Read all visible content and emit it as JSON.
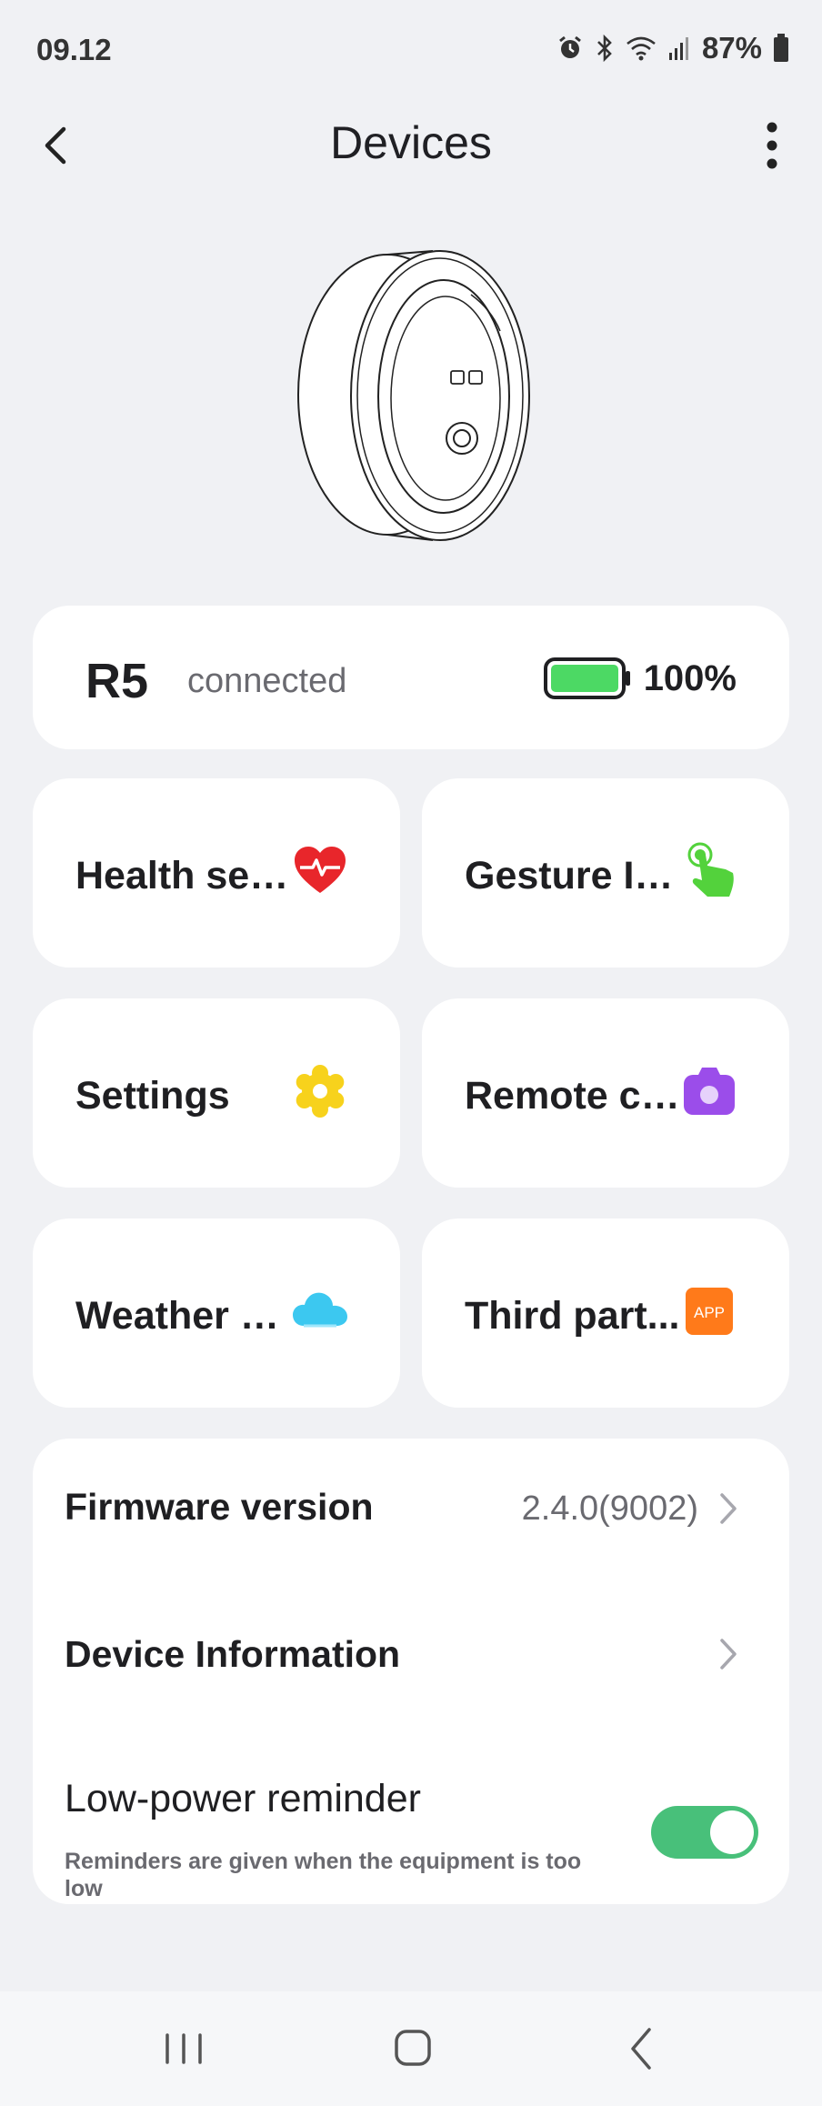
{
  "status_bar": {
    "time": "09.12",
    "battery": "87%",
    "icons": [
      "alarm-icon",
      "bluetooth-icon",
      "wifi-icon",
      "signal-icon",
      "battery-icon"
    ]
  },
  "header": {
    "title": "Devices",
    "back_icon": "back-arrow-icon",
    "menu_icon": "more-vertical-icon"
  },
  "device": {
    "name": "R5",
    "state": "connected",
    "battery_level": "100%",
    "battery_fill": 1.0,
    "battery_color": "#4cd964"
  },
  "tiles": [
    {
      "label": "Health set...",
      "icon": "heart-pulse-icon",
      "color": "#e8262b"
    },
    {
      "label": "Gesture In...",
      "icon": "tap-hand-icon",
      "color": "#53d23c"
    },
    {
      "label": "Settings",
      "icon": "gear-icon",
      "color": "#f7d21c"
    },
    {
      "label": "Remote ca...",
      "icon": "camera-icon",
      "color": "#9b4dea"
    },
    {
      "label": "Weather p...",
      "icon": "cloud-icon",
      "color": "#3cc8f0"
    },
    {
      "label": "Third part...",
      "icon": "app-icon",
      "color": "#ff7a1a",
      "badge_text": "APP"
    }
  ],
  "settings_list": {
    "firmware": {
      "label": "Firmware version",
      "value": "2.4.0(9002)"
    },
    "device_info": {
      "label": "Device Information"
    },
    "low_power": {
      "label": "Low-power reminder",
      "description": "Reminders are given when the equipment is too low",
      "enabled": true,
      "toggle_color": "#48c07a"
    }
  },
  "nav_bar": {
    "icons": [
      "recents-icon",
      "home-icon",
      "back-icon"
    ]
  }
}
